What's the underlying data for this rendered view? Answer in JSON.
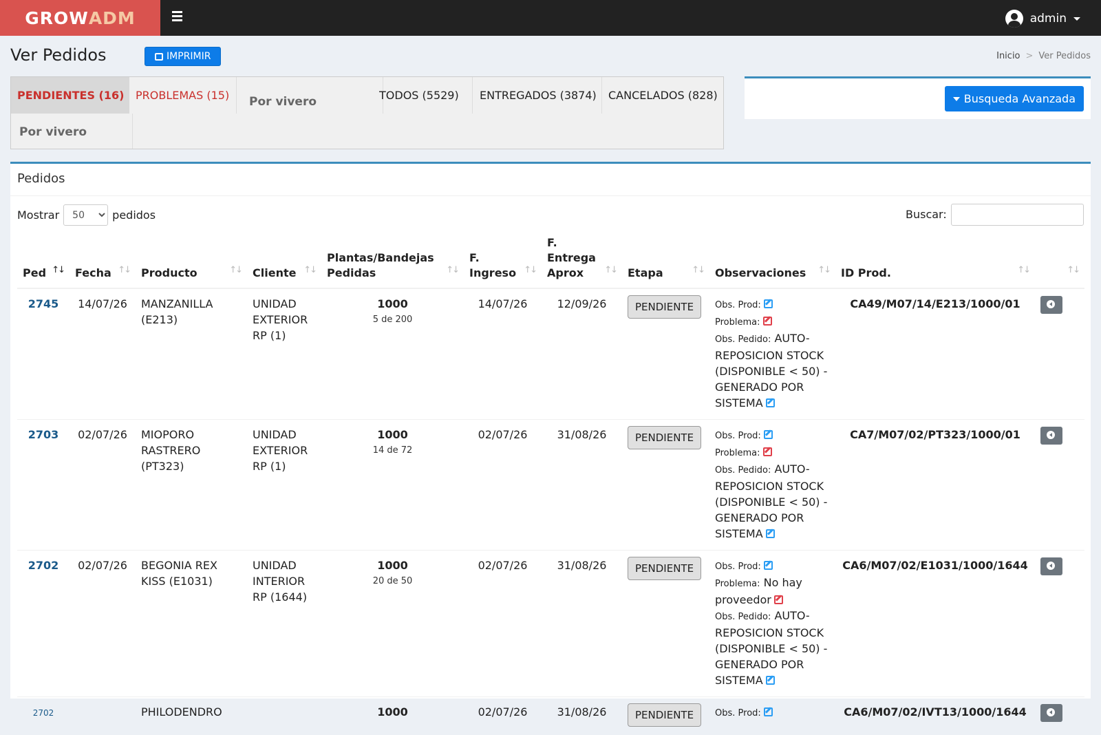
{
  "brand": {
    "part1": "GROW",
    "part2": "ADM"
  },
  "topbar": {
    "user": "admin"
  },
  "header": {
    "title": "Ver Pedidos",
    "print_label": "IMPRIMIR"
  },
  "breadcrumb": {
    "home": "Inicio",
    "sep": ">",
    "current": "Ver Pedidos"
  },
  "tabs": {
    "pendientes": "PENDIENTES (16)",
    "problemas": "PROBLEMAS (15)",
    "todos": "TODOS (5529)",
    "entregados": "ENTREGADOS (3874)",
    "cancelados": "CANCELADOS (828)",
    "vivero1": "Por vivero",
    "vivero2": "Por vivero"
  },
  "search_panel": {
    "button": "Busqueda Avanzada"
  },
  "box": {
    "title": "Pedidos",
    "show_label": "Mostrar",
    "show_value": "50",
    "show_suffix": "pedidos",
    "search_label": "Buscar:"
  },
  "columns": {
    "ped": "Ped",
    "fecha": "Fecha",
    "producto": "Producto",
    "cliente": "Cliente",
    "plantas_1": "Plantas/Bandejas",
    "plantas_2": "Pedidas",
    "ingreso_1": "F.",
    "ingreso_2": "Ingreso",
    "entrega_1": "F.",
    "entrega_2": "Entrega",
    "entrega_3": "Aprox",
    "etapa": "Etapa",
    "observaciones": "Observaciones",
    "id_prod": "ID Prod."
  },
  "labels": {
    "obs_prod": "Obs. Prod:",
    "problema": "Problema:",
    "obs_pedido": "Obs. Pedido:"
  },
  "rows": [
    {
      "ped": "2745",
      "fecha": "14/07/26",
      "producto_1": "MANZANILLA",
      "producto_2": "(E213)",
      "producto_3": "",
      "cliente_1": "UNIDAD",
      "cliente_2": "EXTERIOR",
      "cliente_3": "RP (1)",
      "plantas": "1000",
      "bandejas": "5 de 200",
      "ingreso": "14/07/26",
      "entrega": "12/09/26",
      "etapa": "PENDIENTE",
      "problema": "",
      "obs_pedido": "AUTO-REPOSICION STOCK (DISPONIBLE < 50) - GENERADO POR SISTEMA",
      "id_prod": "CA49/M07/14/E213/1000/01"
    },
    {
      "ped": "2703",
      "fecha": "02/07/26",
      "producto_1": "MIOPORO",
      "producto_2": "RASTRERO",
      "producto_3": "(PT323)",
      "cliente_1": "UNIDAD",
      "cliente_2": "EXTERIOR",
      "cliente_3": "RP (1)",
      "plantas": "1000",
      "bandejas": "14 de 72",
      "ingreso": "02/07/26",
      "entrega": "31/08/26",
      "etapa": "PENDIENTE",
      "problema": "",
      "obs_pedido": "AUTO-REPOSICION STOCK (DISPONIBLE < 50) - GENERADO POR SISTEMA",
      "id_prod": "CA7/M07/02/PT323/1000/01"
    },
    {
      "ped": "2702",
      "fecha": "02/07/26",
      "producto_1": "BEGONIA REX",
      "producto_2": "KISS (E1031)",
      "producto_3": "",
      "cliente_1": "UNIDAD",
      "cliente_2": "INTERIOR",
      "cliente_3": "RP (1644)",
      "plantas": "1000",
      "bandejas": "20 de 50",
      "ingreso": "02/07/26",
      "entrega": "31/08/26",
      "etapa": "PENDIENTE",
      "problema": "No hay proveedor",
      "obs_pedido": "AUTO-REPOSICION STOCK (DISPONIBLE < 50) - GENERADO POR SISTEMA",
      "id_prod": "CA6/M07/02/E1031/1000/1644"
    },
    {
      "ped": "2702",
      "fecha": "",
      "producto_1": "PHILODENDRO",
      "producto_2": "",
      "producto_3": "",
      "cliente_1": "",
      "cliente_2": "",
      "cliente_3": "",
      "plantas": "1000",
      "bandejas": "",
      "ingreso": "02/07/26",
      "entrega": "31/08/26",
      "etapa": "PENDIENTE",
      "problema": "",
      "obs_pedido": "",
      "id_prod": "CA6/M07/02/IVT13/1000/1644"
    }
  ]
}
